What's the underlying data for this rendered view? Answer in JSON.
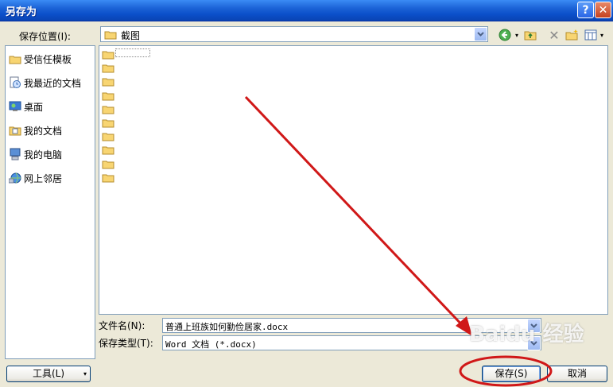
{
  "window": {
    "title": "另存为"
  },
  "location": {
    "label": "保存位置(I):",
    "value": "截图"
  },
  "places": [
    {
      "label": "受信任模板",
      "icon": "folder-icon"
    },
    {
      "label": "我最近的文档",
      "icon": "recent-docs-icon"
    },
    {
      "label": "桌面",
      "icon": "desktop-icon"
    },
    {
      "label": "我的文档",
      "icon": "my-documents-icon"
    },
    {
      "label": "我的电脑",
      "icon": "my-computer-icon"
    },
    {
      "label": "网上邻居",
      "icon": "network-icon"
    }
  ],
  "file_list": {
    "folder_count": 10
  },
  "filename": {
    "label": "文件名(N):",
    "value": "普通上班族如何勤俭居家.docx"
  },
  "filetype": {
    "label": "保存类型(T):",
    "value": "Word 文档 (*.docx)"
  },
  "buttons": {
    "tools": "工具(L)",
    "save": "保存(S)",
    "cancel": "取消"
  },
  "watermark": "Baidu 经验",
  "colors": {
    "annotation": "#d01818",
    "titlebar": "#0b4fc9"
  }
}
